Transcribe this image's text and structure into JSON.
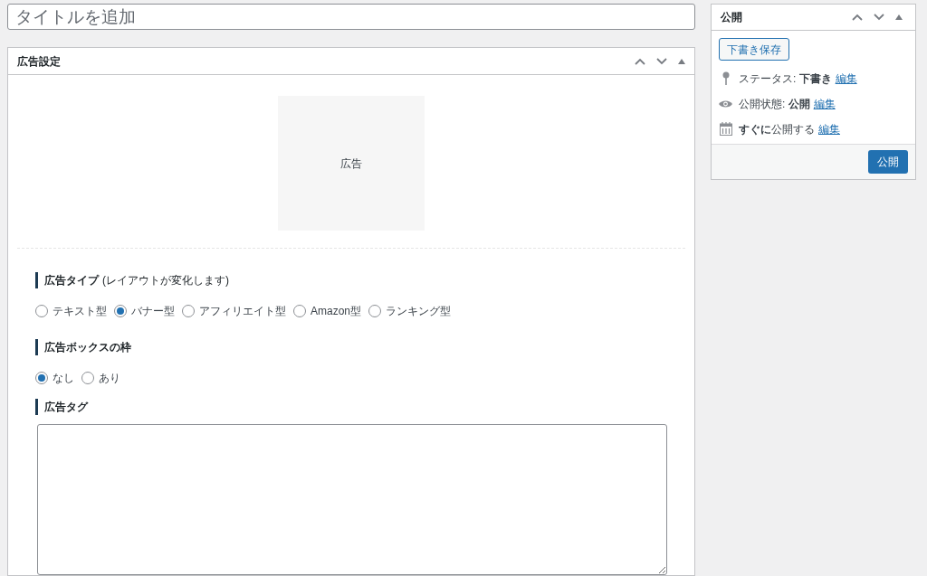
{
  "title_field": {
    "placeholder": "タイトルを追加"
  },
  "ad_panel": {
    "title": "広告設定",
    "preview": "広告",
    "sections": [
      {
        "kind": "radios",
        "heading": "広告タイプ",
        "note": "(レイアウトが変化します)",
        "options": [
          {
            "label": "テキスト型",
            "selected": false
          },
          {
            "label": "バナー型",
            "selected": true
          },
          {
            "label": "アフィリエイト型",
            "selected": false
          },
          {
            "label": "Amazon型",
            "selected": false
          },
          {
            "label": "ランキング型",
            "selected": false
          }
        ]
      },
      {
        "kind": "radios",
        "heading": "広告ボックスの枠",
        "options": [
          {
            "label": "なし",
            "selected": true
          },
          {
            "label": "あり",
            "selected": false
          }
        ]
      },
      {
        "kind": "textarea",
        "heading": "広告タグ"
      }
    ]
  },
  "publish_panel": {
    "title": "公開",
    "save_draft": "下書き保存",
    "rows": [
      {
        "kind": "pin",
        "text": "ステータス: **下書き**",
        "link": "編集"
      },
      {
        "kind": "eye",
        "text": "公開状態: **公開**",
        "link": "編集"
      },
      {
        "kind": "calendar",
        "text": "**すぐに**公開する",
        "link": "編集"
      }
    ],
    "publish_button": "公開"
  }
}
